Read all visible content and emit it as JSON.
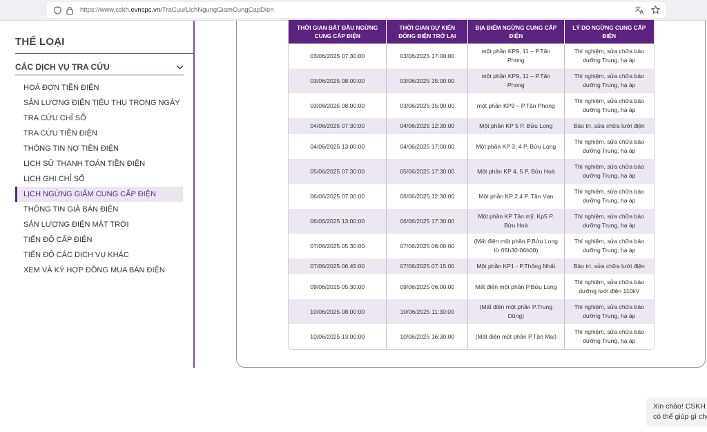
{
  "browser": {
    "url_prefix": "https://www.cskh.",
    "url_domain": "evnspc.vn",
    "url_path": "/TraCuu/LichNgungGiamCungCapDien"
  },
  "sidebar": {
    "title": "THỂ LOẠI",
    "section_label": "CÁC DỊCH VỤ TRA CỨU",
    "items": [
      {
        "label": "HOÁ ĐƠN TIỀN ĐIỆN"
      },
      {
        "label": "SẢN LƯỢNG ĐIỆN TIÊU THỤ TRONG NGÀY"
      },
      {
        "label": "TRA CỨU CHỈ SỐ"
      },
      {
        "label": "TRA CỨU TIỀN ĐIỆN"
      },
      {
        "label": "THÔNG TIN NỢ TIỀN ĐIỆN"
      },
      {
        "label": "LỊCH SỬ THANH TOÁN TIỀN ĐIỆN"
      },
      {
        "label": "LỊCH GHI CHỈ SỐ"
      },
      {
        "label": "LỊCH NGỪNG GIẢM CUNG CẤP ĐIỆN"
      },
      {
        "label": "THÔNG TIN GIÁ BÁN ĐIỆN"
      },
      {
        "label": "SẢN LƯỢNG ĐIỆN MẶT TRỜI"
      },
      {
        "label": "TIẾN ĐỘ CẤP ĐIỆN"
      },
      {
        "label": "TIẾN ĐỘ CÁC DỊCH VỤ KHÁC"
      },
      {
        "label": "XEM VÀ KÝ HỢP ĐỒNG MUA BÁN ĐIỆN"
      }
    ]
  },
  "table": {
    "headers": [
      "THỜI GIAN BẮT ĐẦU NGỪNG CUNG CẤP ĐIỆN",
      "THỜI GIAN DỰ KIẾN ĐÓNG ĐIỆN TRỞ LẠI",
      "ĐỊA ĐIỂM NGỪNG CUNG CẤP ĐIỆN",
      "LÝ DO NGỪNG CUNG CẤP ĐIỆN"
    ],
    "rows": [
      {
        "start": "03/06/2025 07:30:00",
        "end": "03/06/2025 17:00:00",
        "place": "một phần KP9, 11 – P.Tân Phong",
        "reason": "Thí nghiệm, sửa chữa bảo dưỡng Trung, hạ áp"
      },
      {
        "start": "03/06/2025 08:00:00",
        "end": "03/06/2025 15:00:00",
        "place": "một phần KP9, 11 – P.Tân Phong",
        "reason": "Thí nghiệm, sửa chữa bảo dưỡng Trung, hạ áp"
      },
      {
        "start": "03/06/2025 08:00:00",
        "end": "03/06/2025 15:00:00",
        "place": "một phần KP9 – P.Tân Phong",
        "reason": "Thí nghiệm, sửa chữa bảo dưỡng Trung, hạ áp"
      },
      {
        "start": "04/06/2025 07:30:00",
        "end": "04/06/2025 12:30:00",
        "place": "Một phần KP 5 P. Bửu Long",
        "reason": "Bảo trì, sửa chữa lưới điện"
      },
      {
        "start": "04/06/2025 13:00:00",
        "end": "04/06/2025 17:00:00",
        "place": "Một phần KP 3, 4 P. Bửu Long",
        "reason": "Thí nghiệm, sửa chữa bảo dưỡng Trung, hạ áp"
      },
      {
        "start": "05/06/2025 07:30:00",
        "end": "05/06/2025 17:30:00",
        "place": "Một phần KP 4, 5 P. Bửu Hoà",
        "reason": "Thí nghiệm, sửa chữa bảo dưỡng Trung, hạ áp"
      },
      {
        "start": "06/06/2025 07:30:00",
        "end": "06/06/2025 12:30:00",
        "place": "Một phần KP 2,4 P. Tân Vạn",
        "reason": "Thí nghiệm, sửa chữa bảo dưỡng Trung, hạ áp"
      },
      {
        "start": "06/06/2025 13:00:00",
        "end": "06/06/2025 17:30:00",
        "place": "Một phần KP Tân mỹ, Kp5 P. Bửu Hoà",
        "reason": "Thí nghiệm, sửa chữa bảo dưỡng Trung, hạ áp"
      },
      {
        "start": "07/06/2025 05:30:00",
        "end": "07/06/2025 06:00:00",
        "place": "(Mất điện một phần P.Bửu Long từ 05h30-06h00)",
        "reason": "Thí nghiệm, sửa chữa bảo dưỡng Trung, hạ áp"
      },
      {
        "start": "07/06/2025 06:45:00",
        "end": "07/06/2025 07:15:00",
        "place": "Một phần KP1 - P.Thống Nhất",
        "reason": "Bảo trì, sửa chữa lưới điện"
      },
      {
        "start": "09/06/2025 05:30:00",
        "end": "09/06/2025 06:00:00",
        "place": "Mất điện một phần P.Bửu Long",
        "reason": "Thí nghiệm, sửa chữa bảo dưỡng lưới điện 110kV"
      },
      {
        "start": "10/06/2025 08:00:00",
        "end": "10/06/2025 11:30:00",
        "place": "(Mất điện một phần P.Trung Dũng)",
        "reason": "Thí nghiệm, sửa chữa bảo dưỡng Trung, hạ áp"
      },
      {
        "start": "10/06/2025 13:00:00",
        "end": "10/06/2025 16:30:00",
        "place": "(Mất điện một phần P.Tân Mai)",
        "reason": "Thí nghiệm, sửa chữa bảo dưỡng Trung, hạ áp"
      }
    ]
  },
  "chat": {
    "line1": "Xin chào! CSKH E",
    "line2": "có thể giúp gì cho"
  },
  "colors": {
    "accent": "#5a2480",
    "row_alt": "#ece7f0",
    "border": "#7b4f8e"
  }
}
